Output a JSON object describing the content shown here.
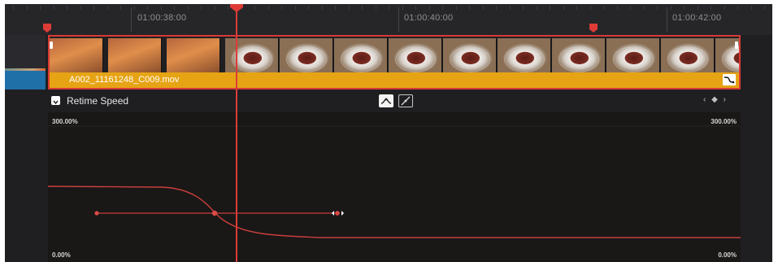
{
  "ruler": {
    "timecodes": [
      "01:00:38:00",
      "01:00:40:00",
      "01:00:42:00"
    ]
  },
  "clip": {
    "name": "A002_11161248_C009.mov"
  },
  "retime_panel": {
    "title": "Retime Speed",
    "max_left": "300.00%",
    "max_right": "300.00%",
    "min_left": "0.00%",
    "min_right": "0.00%",
    "keyframe_nav": "‹ ◆ ›"
  },
  "colors": {
    "playhead": "#dd3c37",
    "clip_bar": "#e6a415",
    "track_label": "#1f6fa8"
  },
  "icons": {
    "dropdown": "chevron-down-icon",
    "smooth_curve": "smooth-curve-icon",
    "linear_curve": "linear-curve-icon",
    "retime_toggle": "retime-curve-icon"
  }
}
